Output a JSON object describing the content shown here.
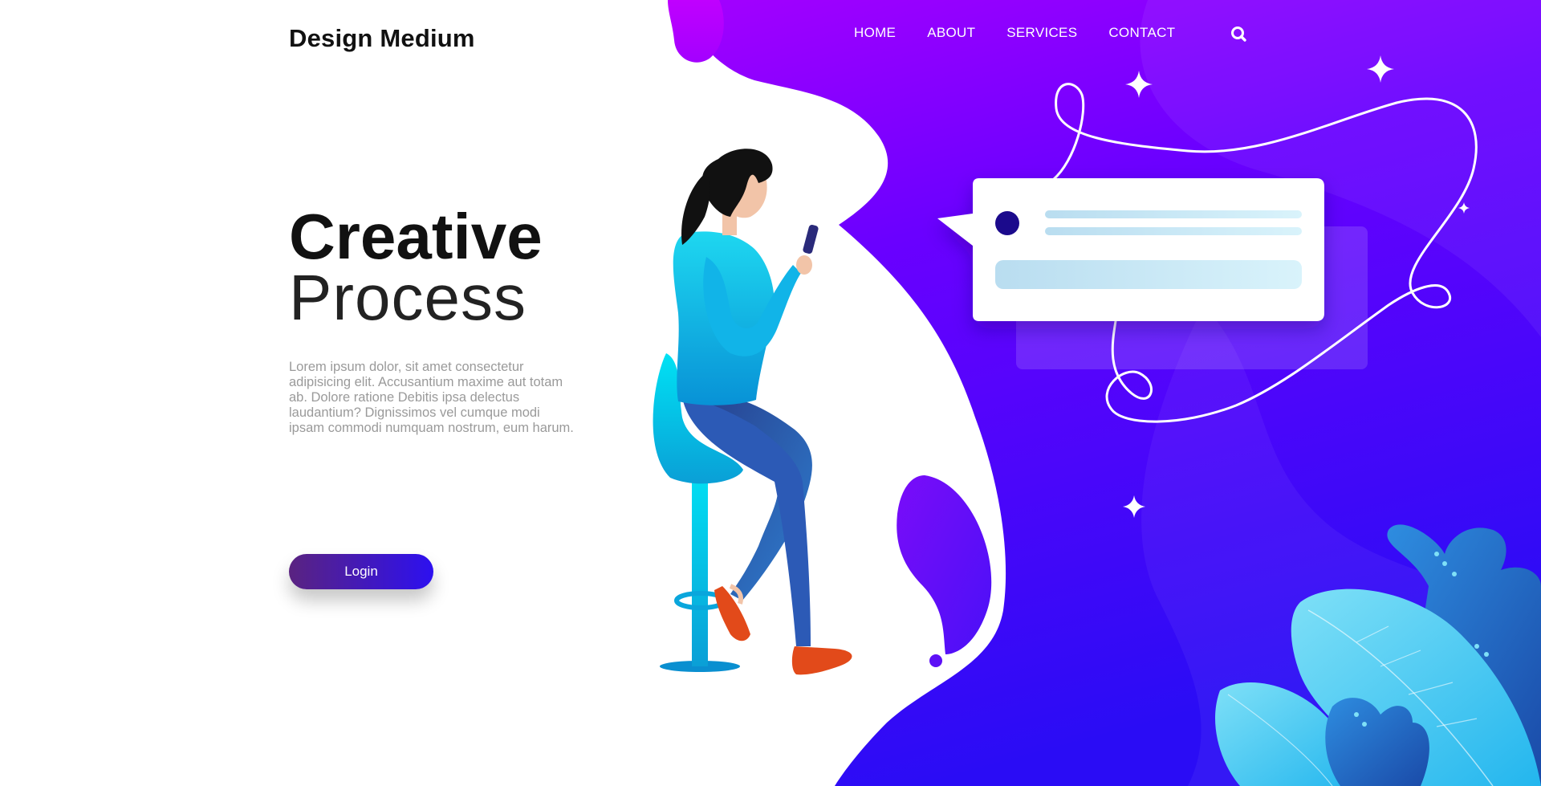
{
  "brand": {
    "name": "Design Medium"
  },
  "nav": {
    "items": [
      {
        "label": "HOME"
      },
      {
        "label": "ABOUT"
      },
      {
        "label": "SERVICES"
      },
      {
        "label": "CONTACT"
      }
    ],
    "search_icon": "search-icon"
  },
  "hero": {
    "title_line1": "Creative",
    "title_line2": "Process",
    "description": "Lorem ipsum dolor, sit amet consectetur adipisicing elit. Accusantium maxime aut totam ab. Dolore ratione Debitis ipsa delectus laudantium? Dignissimos vel cumque modi ipsam commodi numquam nostrum, eum harum.",
    "login_label": "Login"
  },
  "illustration": {
    "subject": "woman-on-stool-with-phone",
    "chat_bubble_icon": "chat-bubble-icon",
    "sparkle_icon": "sparkle-icon",
    "leaf_icon": "leaf-icon"
  },
  "colors": {
    "purple_top": "#a100ff",
    "blue_bottom": "#2a0cf5",
    "button_start": "#5a2380",
    "button_end": "#2d10f0",
    "figure_cyan": "#00c8ee",
    "leaf_light": "#5fd6f4",
    "leaf_dark": "#2d6fc4"
  }
}
